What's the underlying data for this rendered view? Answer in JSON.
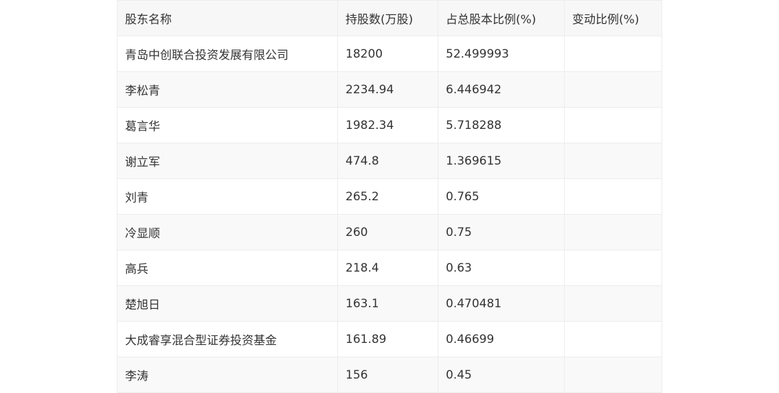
{
  "table": {
    "headers": [
      "股东名称",
      "持股数(万股)",
      "占总股本比例(%)",
      "变动比例(%)"
    ],
    "rows": [
      [
        "青岛中创联合投资发展有限公司",
        "18200",
        "52.499993",
        ""
      ],
      [
        "李松青",
        "2234.94",
        "6.446942",
        ""
      ],
      [
        "葛言华",
        "1982.34",
        "5.718288",
        ""
      ],
      [
        "谢立军",
        "474.8",
        "1.369615",
        ""
      ],
      [
        "刘青",
        "265.2",
        "0.765",
        ""
      ],
      [
        "冷显顺",
        "260",
        "0.75",
        ""
      ],
      [
        "高兵",
        "218.4",
        "0.63",
        ""
      ],
      [
        "楚旭日",
        "163.1",
        "0.470481",
        ""
      ],
      [
        "大成睿享混合型证券投资基金",
        "161.89",
        "0.46699",
        ""
      ],
      [
        "李涛",
        "156",
        "0.45",
        ""
      ]
    ]
  }
}
